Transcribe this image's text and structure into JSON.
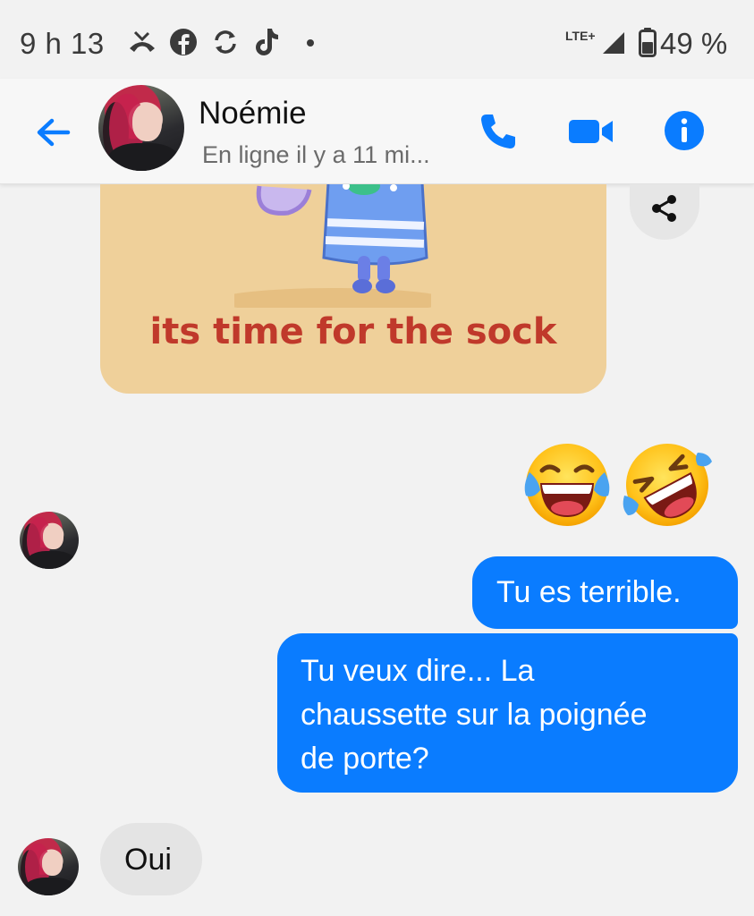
{
  "status_bar": {
    "time": "9 h 13",
    "network": "LTE+",
    "battery": "49 %",
    "icons": [
      "missed-call-icon",
      "facebook-icon",
      "sync-icon",
      "tiktok-icon",
      "dot-icon",
      "signal-icon",
      "battery-icon"
    ]
  },
  "header": {
    "contact_name": "Noémie",
    "contact_status": "En ligne il y a 11 mi...",
    "icons": [
      "back-arrow-icon",
      "phone-icon",
      "video-camera-icon",
      "info-icon"
    ],
    "accent_color": "#0a7cff"
  },
  "messages": [
    {
      "type": "sticker",
      "from": "contact",
      "caption": "its time for the sock"
    },
    {
      "type": "emoji",
      "from": "me",
      "emojis": [
        "😂",
        "🤣"
      ]
    },
    {
      "type": "text",
      "from": "me",
      "text": "Tu es terrible."
    },
    {
      "type": "text",
      "from": "me",
      "text_lines": [
        "Tu veux dire... La",
        "chaussette sur la poignée",
        "de porte?"
      ]
    },
    {
      "type": "text",
      "from": "contact",
      "text": "Oui"
    }
  ],
  "colors": {
    "sent_bubble": "#0a7cff",
    "received_bubble": "#e4e4e4",
    "sticker_background": "#efd09a",
    "sticker_caption": "#c0392b"
  }
}
